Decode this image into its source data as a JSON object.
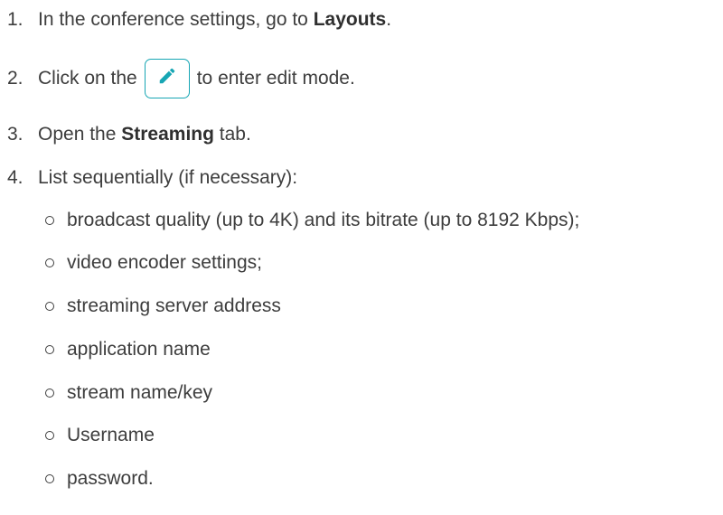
{
  "steps": [
    {
      "number": "1.",
      "text_before": "In the conference settings, go to ",
      "bold": "Layouts",
      "text_after": "."
    },
    {
      "number": "2.",
      "text_before": "Click on the",
      "icon": "pencil-edit-icon",
      "text_after": "to enter edit mode."
    },
    {
      "number": "3.",
      "text_before": "Open the ",
      "bold": "Streaming",
      "text_after": " tab."
    },
    {
      "number": "4.",
      "text": "List sequentially (if necessary):",
      "subitems": [
        "broadcast quality (up to 4K) and its bitrate (up to 8192 Kbps);",
        "video encoder settings;",
        "streaming server address",
        "application name",
        "stream name/key",
        "Username",
        "password."
      ]
    }
  ],
  "colors": {
    "accent": "#17a6b4",
    "text": "#3d3d3d"
  }
}
